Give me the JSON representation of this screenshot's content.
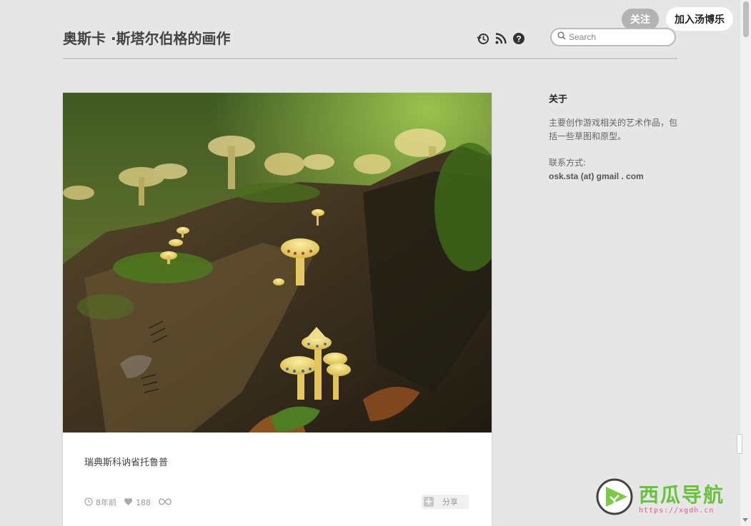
{
  "header": {
    "follow_label": "关注",
    "join_label": "加入汤博乐",
    "blog_title": "奥斯卡 ·斯塔尔伯格的画作",
    "icons": [
      "history-icon",
      "rss-icon",
      "help-icon"
    ],
    "search_placeholder": "Search"
  },
  "post": {
    "caption": "瑞典斯科讷省托鲁普",
    "time_ago": "8年前",
    "likes": "188",
    "share_label": "分享",
    "image_description_icons": [
      "clock-icon",
      "heart-icon",
      "reblog-icon",
      "plus-icon"
    ]
  },
  "sidebar": {
    "heading": "关于",
    "desc": "主要创作游戏相关的艺术作品，包括一些草图和原型。",
    "contact_label": "联系方式:",
    "contact_value": "osk.sta (at) gmail . com"
  },
  "watermark": {
    "text": "西瓜导航",
    "url": "https://xgdh.cn"
  },
  "colors": {
    "background": "#e6e6e6",
    "follow_button": "#b3b3b3",
    "watermark_green": "#6ac23a",
    "watermark_pink": "#e05a8a"
  }
}
